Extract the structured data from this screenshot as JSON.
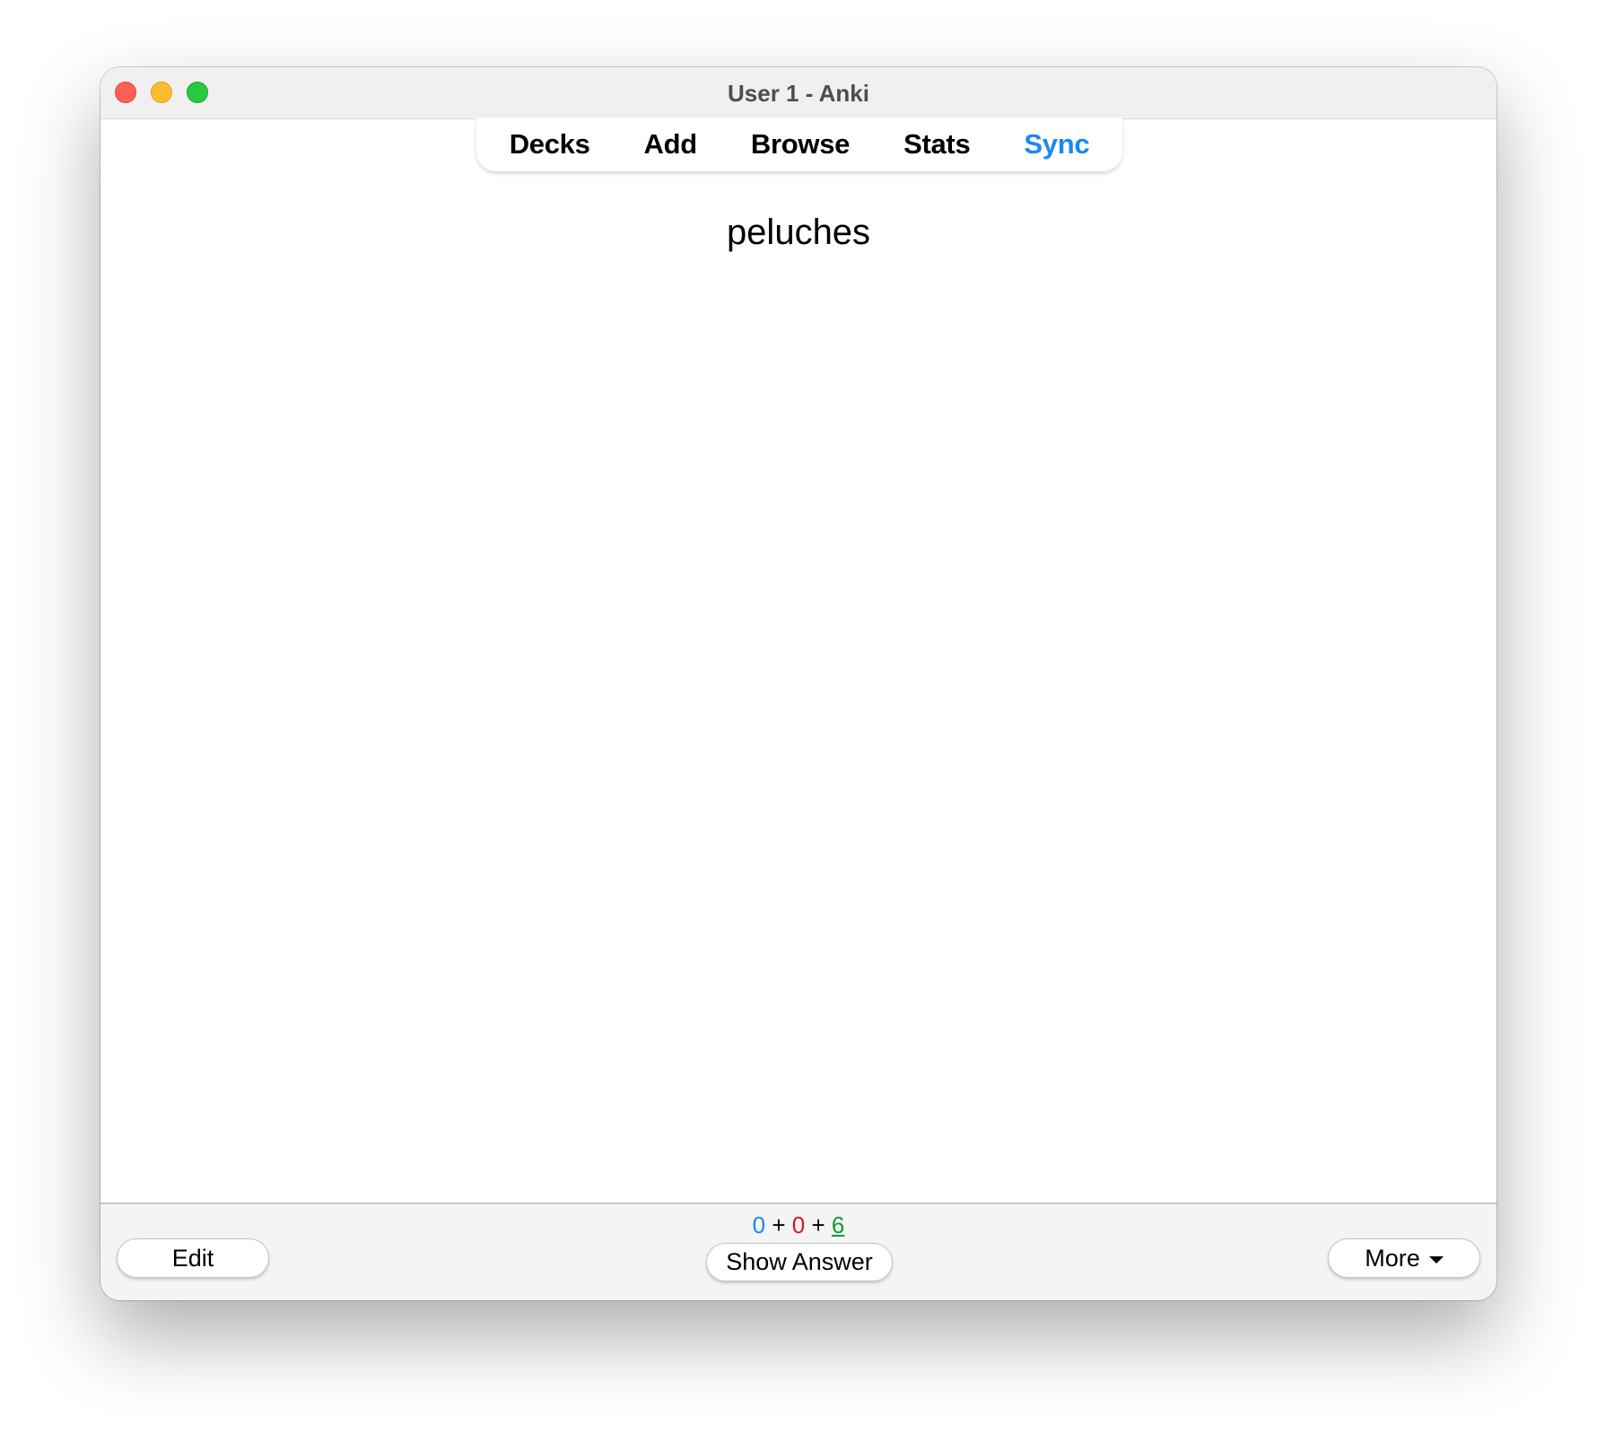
{
  "window": {
    "title": "User 1 - Anki",
    "controls": [
      "close",
      "minimize",
      "maximize"
    ]
  },
  "toolbar": {
    "items": [
      {
        "label": "Decks",
        "active": false
      },
      {
        "label": "Add",
        "active": false
      },
      {
        "label": "Browse",
        "active": false
      },
      {
        "label": "Stats",
        "active": false
      },
      {
        "label": "Sync",
        "active": true
      }
    ]
  },
  "card": {
    "question": "peluches"
  },
  "bottom_bar": {
    "edit_label": "Edit",
    "show_answer_label": "Show Answer",
    "more_label": "More",
    "counts": {
      "new": "0",
      "learning": "0",
      "review": "6",
      "separator": "+"
    }
  },
  "colors": {
    "accent": "#1b87f7",
    "new_count": "#1b87f7",
    "learning_count": "#e0141e",
    "review_count": "#129b31"
  }
}
